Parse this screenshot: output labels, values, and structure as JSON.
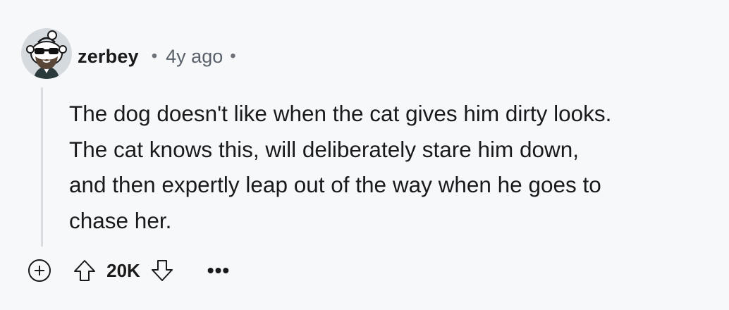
{
  "comment": {
    "author": "zerbey",
    "separator": "•",
    "timestamp": "4y ago",
    "trailing_separator": "•",
    "body": [
      "The dog doesn't like when the cat gives him dirty looks.",
      "The cat knows this, will deliberately stare him down,",
      "and then expertly leap out of the way when he goes to",
      "chase her."
    ],
    "score": "20K",
    "more_label": "•••"
  },
  "icons": {
    "avatar": "snoo-avatar-sunglasses-beard",
    "expand": "plus-circle-icon",
    "upvote": "arrow-up-outline-icon",
    "downvote": "arrow-down-outline-icon",
    "more": "more-horizontal-icon"
  },
  "colors": {
    "background": "#f7f8fa",
    "text": "#1a1a1b",
    "muted": "#59616a",
    "thread_line": "#d9dde1"
  }
}
